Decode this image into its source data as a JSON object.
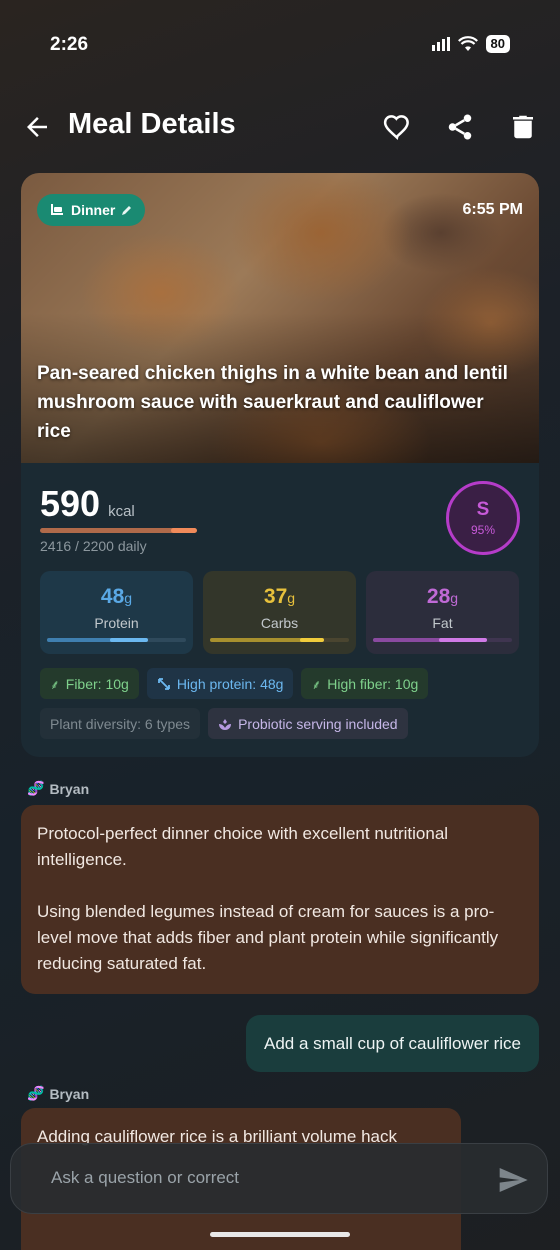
{
  "status": {
    "time": "2:26",
    "battery": "80"
  },
  "header": {
    "title": "Meal Details"
  },
  "meal": {
    "type_chip": "Dinner",
    "time": "6:55 PM",
    "name": "Pan-seared chicken thighs in a white bean and lentil mushroom sauce with sauerkraut and cauliflower rice",
    "kcal": "590",
    "kcal_unit": "kcal",
    "daily": "2416 / 2200 daily",
    "daily_progress": 1.0,
    "score_letter": "S",
    "score_pct": "95%"
  },
  "macros": [
    {
      "value": "48",
      "unit": "g",
      "label": "Protein",
      "color": "#5aa9e6",
      "track": "#2f4a5c"
    },
    {
      "value": "37",
      "unit": "g",
      "label": "Carbs",
      "color": "#e8c13c",
      "track": "#4a4530"
    },
    {
      "value": "28",
      "unit": "g",
      "label": "Fat",
      "color": "#c06ad6",
      "track": "#3f3550"
    }
  ],
  "tags": {
    "row1": [
      {
        "label": "Fiber: 10g",
        "icon": "leaf-icon"
      },
      {
        "label": "High protein: 48g",
        "icon": "trend-arrows-icon"
      },
      {
        "label": "High fiber: 10g",
        "icon": "leaf-icon"
      }
    ],
    "row2": [
      {
        "label": "Plant diversity: 6 types"
      },
      {
        "label": "Probiotic serving included",
        "icon": "probiotic-icon"
      }
    ]
  },
  "chat": {
    "sender": "Bryan",
    "message1_p1": "Protocol-perfect dinner choice with excellent nutritional intelligence.",
    "message1_p2": "Using blended legumes instead of cream for sauces is a pro-level move that adds fiber and plant protein while significantly reducing saturated fat.",
    "user_message": "Add a small cup of cauliflower rice",
    "message2_partial": "Adding cauliflower rice is a brilliant volume hack"
  },
  "input": {
    "placeholder": "Ask a question or correct"
  }
}
